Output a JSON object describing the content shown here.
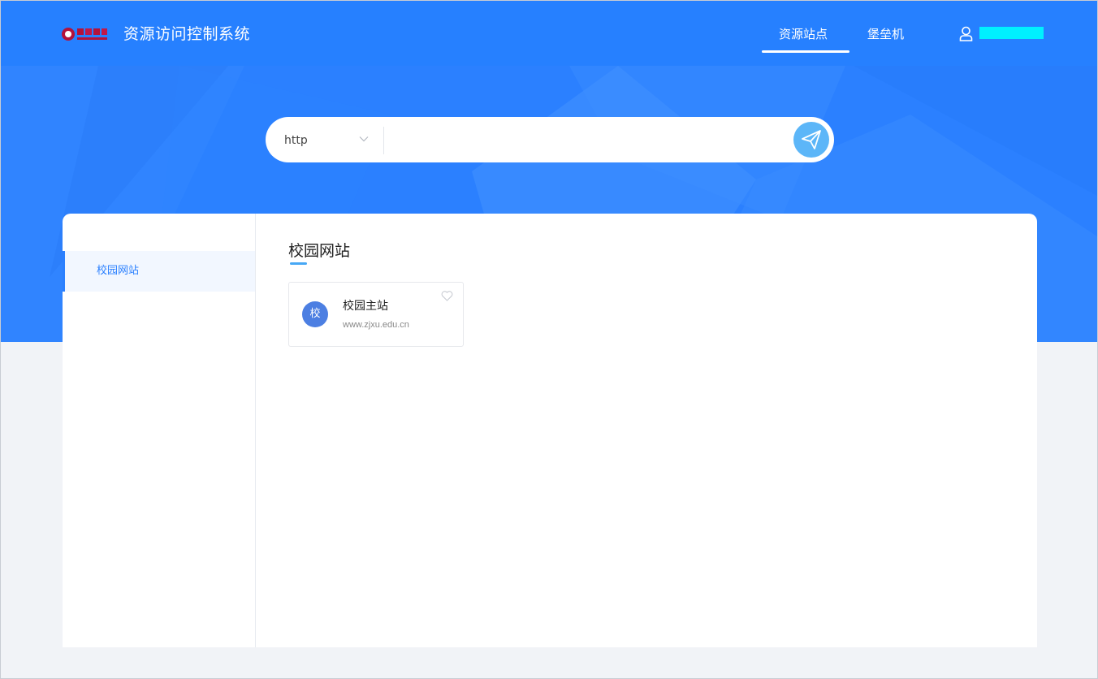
{
  "header": {
    "app_title": "资源访问控制系统",
    "nav": [
      {
        "label": "资源站点",
        "active": true
      },
      {
        "label": "堡垒机",
        "active": false
      }
    ],
    "user_icon": "user-icon"
  },
  "search": {
    "protocol": "http",
    "protocol_icon": "chevron-down-icon",
    "placeholder": "",
    "submit_icon": "paper-plane-icon"
  },
  "sidebar": {
    "items": [
      {
        "label": "校园网站",
        "active": true
      }
    ]
  },
  "main": {
    "section_title": "校园网站",
    "cards": [
      {
        "avatar_text": "校",
        "name": "校园主站",
        "url": "www.zjxu.edu.cn",
        "fav_icon": "heart-outline-icon"
      }
    ]
  },
  "colors": {
    "brand_blue": "#2b80ff",
    "accent_light_blue": "#5cb6f8",
    "avatar_blue": "#4c7fe2",
    "username_redacted": "#00f0ff"
  }
}
